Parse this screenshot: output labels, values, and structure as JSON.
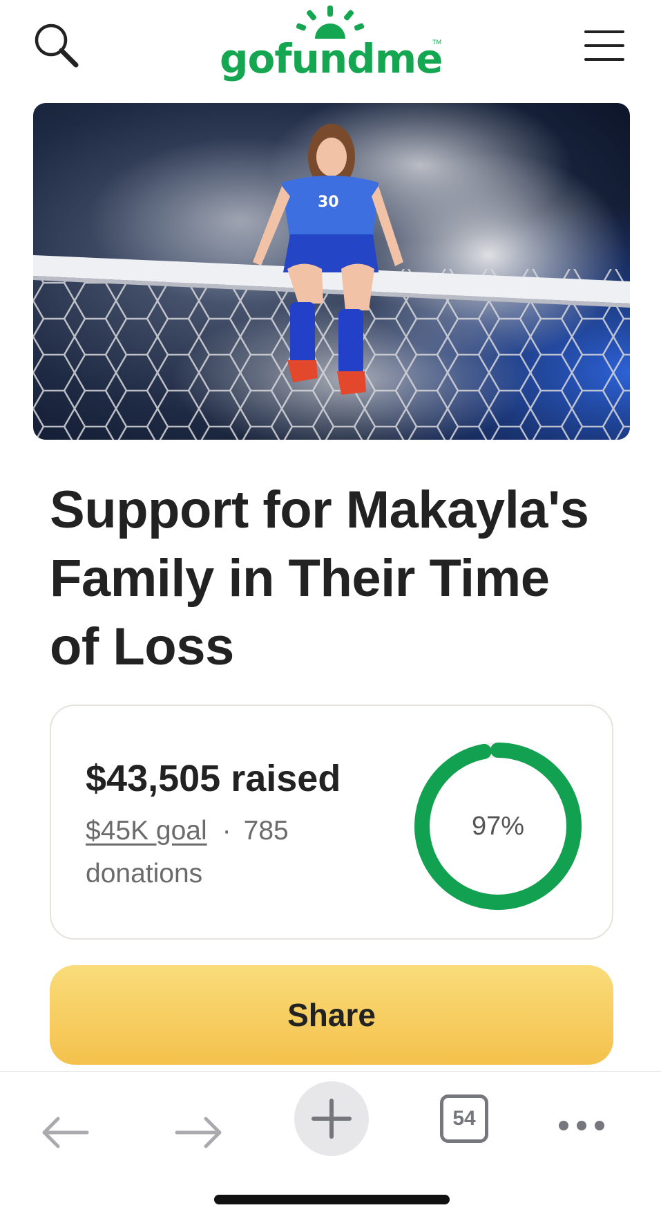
{
  "header": {
    "logo_text": "gofundme",
    "logo_tm": "TM",
    "search_icon": "search-icon",
    "menu_icon": "hamburger-menu-icon"
  },
  "hero": {
    "image": "photo of a soccer player in a blue uniform sitting on a goal crossbar with smoke"
  },
  "campaign": {
    "title": "Support for Makayla's Family in Their Time of Loss",
    "raised": "$43,505 raised",
    "goal": "$45K goal",
    "separator": "·",
    "donations": "785 donations",
    "progress_label": "97%",
    "progress_fraction": 0.97
  },
  "share_button": {
    "label": "Share"
  },
  "toolbar": {
    "back_icon": "arrow-left-icon",
    "forward_icon": "arrow-right-icon",
    "new_tab_icon": "plus-icon",
    "tab_count": "54",
    "more_icon": "more-dots-icon"
  },
  "colors": {
    "brand_green": "#14a650",
    "progress_green": "#12a150",
    "share_yellow": "#f6cc5e",
    "title_text": "#222222"
  }
}
